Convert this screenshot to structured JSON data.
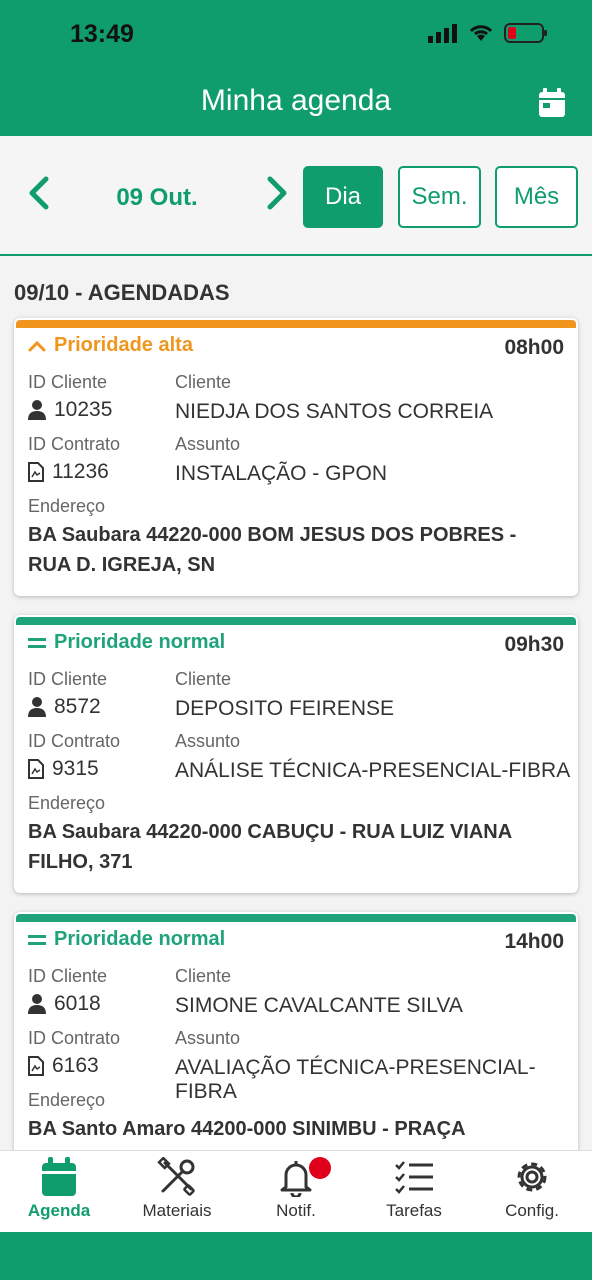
{
  "status_bar": {
    "time": "13:49"
  },
  "header": {
    "title": "Minha agenda"
  },
  "toolbar": {
    "date_label": "09 Out.",
    "views": {
      "day": "Dia",
      "week": "Sem.",
      "month": "Mês"
    },
    "active_view": "Dia"
  },
  "section_title": "09/10 - AGENDADAS",
  "labels": {
    "client_id": "ID Cliente",
    "client": "Cliente",
    "contract_id": "ID Contrato",
    "subject": "Assunto",
    "address": "Endereço"
  },
  "appointments": [
    {
      "priority": "Prioridade alta",
      "priority_color": "#f0961e",
      "time": "08h00",
      "client_id": "10235",
      "client": "NIEDJA DOS SANTOS CORREIA",
      "contract_id": "11236",
      "subject": "INSTALAÇÃO - GPON",
      "address": "BA Saubara 44220-000 BOM JESUS DOS POBRES - RUA D. IGREJA, SN"
    },
    {
      "priority": "Prioridade normal",
      "priority_color": "#1fa37a",
      "time": "09h30",
      "client_id": "8572",
      "client": "DEPOSITO FEIRENSE",
      "contract_id": "9315",
      "subject": "ANÁLISE TÉCNICA-PRESENCIAL-FIBRA",
      "address": "BA Saubara 44220-000 CABUÇU - RUA LUIZ VIANA FILHO, 371"
    },
    {
      "priority": "Prioridade normal",
      "priority_color": "#1fa37a",
      "time": "14h00",
      "client_id": "6018",
      "client": "SIMONE CAVALCANTE SILVA",
      "contract_id": "6163",
      "subject": "AVALIAÇÃO TÉCNICA-PRESENCIAL-FIBRA",
      "address": "BA Santo Amaro 44200-000 SINIMBU - PRAÇA"
    }
  ],
  "tabs": [
    {
      "label": "Agenda",
      "icon": "calendar-icon",
      "active": true
    },
    {
      "label": "Materiais",
      "icon": "tools-icon"
    },
    {
      "label": "Notif.",
      "icon": "bell-icon",
      "badge": true
    },
    {
      "label": "Tarefas",
      "icon": "checklist-icon"
    },
    {
      "label": "Config.",
      "icon": "gear-icon"
    }
  ],
  "colors": {
    "brand": "#0f9d6e",
    "high_priority": "#f0961e",
    "normal_priority": "#1fa37a",
    "badge": "#e0001a"
  }
}
